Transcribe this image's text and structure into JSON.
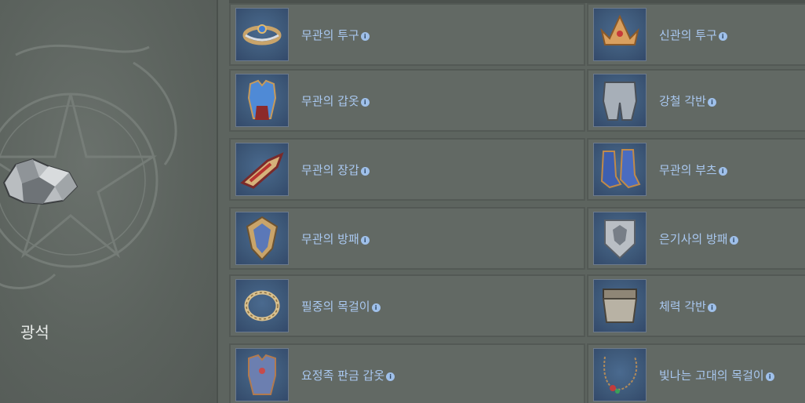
{
  "material": {
    "name": "광석",
    "image_icon": "ore-stone-icon"
  },
  "items_left": [
    {
      "label": "무관의 투구",
      "icon": "circlet-helmet-icon"
    },
    {
      "label": "무관의 갑옷",
      "icon": "chest-armor-icon"
    },
    {
      "label": "무관의 장갑",
      "icon": "gauntlet-icon"
    },
    {
      "label": "무관의 방패",
      "icon": "kite-shield-icon"
    },
    {
      "label": "필중의 목걸이",
      "icon": "ring-necklace-icon"
    },
    {
      "label": "요정족 판금 갑옷",
      "icon": "plate-armor-icon"
    }
  ],
  "items_right": [
    {
      "label": "신관의 투구",
      "icon": "crown-icon"
    },
    {
      "label": "강철 각반",
      "icon": "steel-greaves-icon"
    },
    {
      "label": "무관의 부츠",
      "icon": "boots-icon"
    },
    {
      "label": "은기사의 방패",
      "icon": "tower-shield-icon"
    },
    {
      "label": "체력 각반",
      "icon": "belt-greaves-icon"
    },
    {
      "label": "빛나는 고대의 목걸이",
      "icon": "gem-necklace-icon"
    }
  ],
  "colors": {
    "background": "#5d645f",
    "link_text": "#a9c8f0",
    "thumb_bg": "#3d5878"
  }
}
